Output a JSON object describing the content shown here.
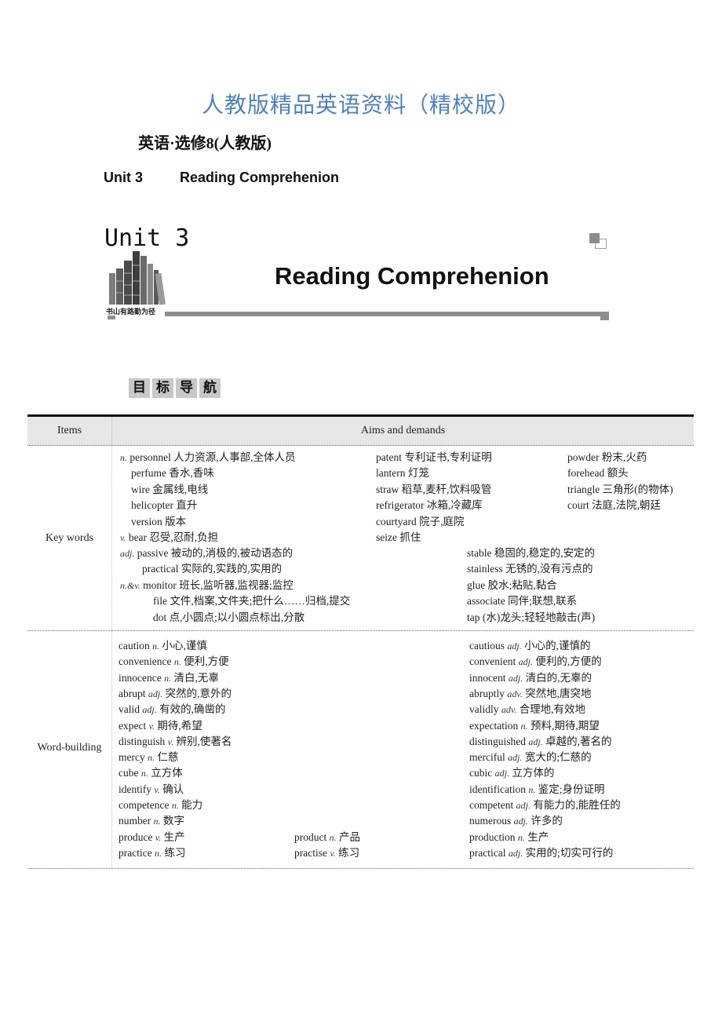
{
  "header": {
    "main_title": "人教版精品英语资料（精校版）",
    "subtitle": "英语·选修8(人教版)",
    "unit_number": "Unit 3",
    "unit_title": "Reading Comprehenion"
  },
  "banner": {
    "unit": "Unit 3",
    "heading": "Reading Comprehenion",
    "motto": "书山有路勤为径",
    "image": "bookshelf-image",
    "corner_icon": "overlapping-squares-icon",
    "accent_color": "#8f8f8f"
  },
  "section_label": [
    "目",
    "标",
    "导",
    "航"
  ],
  "table": {
    "headers": {
      "items": "Items",
      "aims": "Aims and demands"
    },
    "key_words": {
      "label": "Key words",
      "col1": [
        {
          "pos": "n.",
          "word": "personnel",
          "meaning": "人力资源,人事部,全体人员"
        },
        {
          "pos": "",
          "word": "perfume",
          "meaning": "香水,香味"
        },
        {
          "pos": "",
          "word": "wire",
          "meaning": "金属线,电线"
        },
        {
          "pos": "",
          "word": "helicopter",
          "meaning": "直升"
        },
        {
          "pos": "",
          "word": "version",
          "meaning": "版本"
        },
        {
          "pos": "v.",
          "word": "bear",
          "meaning": "忍受,忍耐,负担"
        }
      ],
      "col2": [
        {
          "word": "patent",
          "meaning": "专利证书,专利证明"
        },
        {
          "word": "lantern",
          "meaning": "灯笼"
        },
        {
          "word": "straw",
          "meaning": "稻草,麦秆,饮料吸管"
        },
        {
          "word": "refrigerator",
          "meaning": "冰箱,冷藏库"
        },
        {
          "word": "courtyard",
          "meaning": "院子,庭院"
        },
        {
          "word": "seize",
          "meaning": "抓住"
        }
      ],
      "col3": [
        {
          "word": "powder",
          "meaning": "粉末,火药"
        },
        {
          "word": "forehead",
          "meaning": "额头"
        },
        {
          "word": "triangle",
          "meaning": "三角形(的物体)"
        },
        {
          "word": "court",
          "meaning": "法庭,法院,朝廷"
        }
      ],
      "lower_left": [
        {
          "pos": "adj.",
          "word": "passive",
          "meaning": "被动的,消极的,被动语态的"
        },
        {
          "pos": "",
          "word": "practical",
          "meaning": "实际的,实践的,实用的"
        },
        {
          "pos": "n.&v.",
          "word": "monitor",
          "meaning": "班长,监听器,监视器;监控"
        },
        {
          "pos": "",
          "word": "file",
          "meaning": "文件,档案,文件夹;把什么……归档,提交"
        },
        {
          "pos": "",
          "word": "dot",
          "meaning": "点,小圆点;以小圆点标出,分散"
        }
      ],
      "lower_right": [
        {
          "word": "stable",
          "meaning": "稳固的,稳定的,安定的"
        },
        {
          "word": "stainless",
          "meaning": "无锈的,没有污点的"
        },
        {
          "word": "glue",
          "meaning": "胶水;粘贴,黏合"
        },
        {
          "word": "associate",
          "meaning": "同伴;联想,联系"
        },
        {
          "word": "tap",
          "meaning": "(水)龙头;轻轻地敲击(声)"
        }
      ]
    },
    "word_building": {
      "label": "Word-building",
      "left": [
        {
          "word": "caution",
          "pos": "n.",
          "meaning": "小心,谨慎"
        },
        {
          "word": "convenience",
          "pos": "n.",
          "meaning": "便利,方便"
        },
        {
          "word": "innocence",
          "pos": "n.",
          "meaning": "清白,无辜"
        },
        {
          "word": "abrupt",
          "pos": "adj.",
          "meaning": "突然的,意外的"
        },
        {
          "word": "valid",
          "pos": "adj.",
          "meaning": "有效的,确凿的"
        },
        {
          "word": "expect",
          "pos": "v.",
          "meaning": "期待,希望"
        },
        {
          "word": "distinguish",
          "pos": "v.",
          "meaning": "辨别,使著名"
        },
        {
          "word": "mercy",
          "pos": "n.",
          "meaning": "仁慈"
        },
        {
          "word": "cube",
          "pos": "n.",
          "meaning": "立方体"
        },
        {
          "word": "identify",
          "pos": "v.",
          "meaning": "确认"
        },
        {
          "word": "competence",
          "pos": "n.",
          "meaning": "能力"
        },
        {
          "word": "number",
          "pos": "n.",
          "meaning": "数字"
        },
        {
          "word": "produce",
          "pos": "v.",
          "meaning": "生产"
        },
        {
          "word": "practice",
          "pos": "n.",
          "meaning": "练习"
        }
      ],
      "middle": [
        {
          "word": "product",
          "pos": "n.",
          "meaning": "产品"
        },
        {
          "word": "practise",
          "pos": "v.",
          "meaning": "练习"
        }
      ],
      "right": [
        {
          "word": "cautious",
          "pos": "adj.",
          "meaning": "小心的,谨慎的"
        },
        {
          "word": "convenient",
          "pos": "adj.",
          "meaning": "便利的,方便的"
        },
        {
          "word": "innocent",
          "pos": "adj.",
          "meaning": "清白的,无辜的"
        },
        {
          "word": "abruptly",
          "pos": "adv.",
          "meaning": "突然地,唐突地"
        },
        {
          "word": "validly",
          "pos": "adv.",
          "meaning": "合理地,有效地"
        },
        {
          "word": "expectation",
          "pos": "n.",
          "meaning": "预料,期待,期望"
        },
        {
          "word": "distinguished",
          "pos": "adj.",
          "meaning": "卓越的,著名的"
        },
        {
          "word": "merciful",
          "pos": "adj.",
          "meaning": "宽大的;仁慈的"
        },
        {
          "word": "cubic",
          "pos": "adj.",
          "meaning": "立方体的"
        },
        {
          "word": "identification",
          "pos": "n.",
          "meaning": "鉴定;身份证明"
        },
        {
          "word": "competent",
          "pos": "adj.",
          "meaning": "有能力的,能胜任的"
        },
        {
          "word": "numerous",
          "pos": "adj.",
          "meaning": "许多的"
        },
        {
          "word": "production",
          "pos": "n.",
          "meaning": "生产"
        },
        {
          "word": "practical",
          "pos": "adj.",
          "meaning": "实用的;切实可行的"
        }
      ]
    }
  }
}
